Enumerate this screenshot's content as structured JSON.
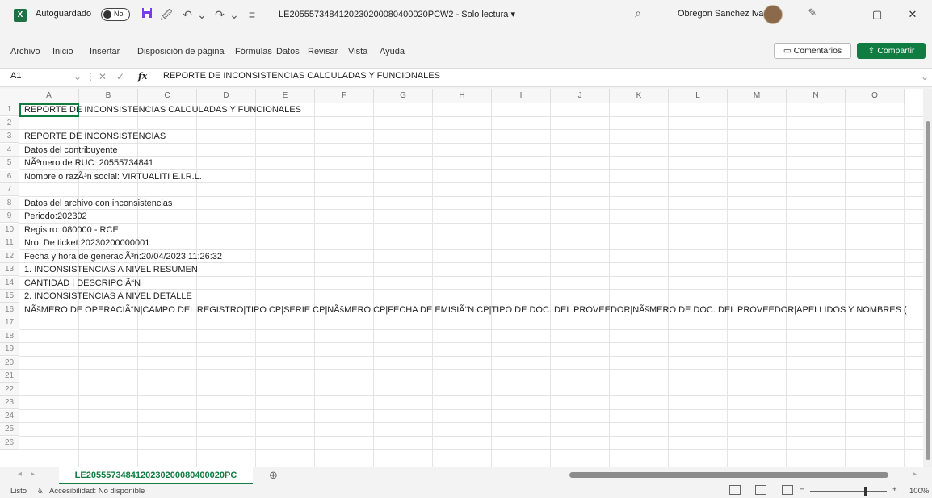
{
  "titlebar": {
    "app_icon": "X",
    "autosave_label": "Autoguardado",
    "autosave_state": "No",
    "doc_title": "LE2055573484120230200080400020PCW2 - Solo lectura ▾",
    "username": "Obregon Sanchez Ivan"
  },
  "menu": {
    "tabs": [
      "Archivo",
      "Inicio",
      "Insertar",
      "Disposición de página",
      "Fórmulas",
      "Datos",
      "Revisar",
      "Vista",
      "Ayuda"
    ],
    "comments_label": "Comentarios",
    "share_label": "Compartir"
  },
  "formula_bar": {
    "name_box": "A1",
    "fx": "fx",
    "content": "REPORTE DE INCONSISTENCIAS CALCULADAS Y FUNCIONALES"
  },
  "columns": [
    "A",
    "B",
    "C",
    "D",
    "E",
    "F",
    "G",
    "H",
    "I",
    "J",
    "K",
    "L",
    "M",
    "N",
    "O"
  ],
  "rows": [
    "1",
    "2",
    "3",
    "4",
    "5",
    "6",
    "7",
    "8",
    "9",
    "10",
    "11",
    "12",
    "13",
    "14",
    "15",
    "16",
    "17",
    "18",
    "19",
    "20",
    "21",
    "22",
    "23",
    "24",
    "25",
    "26"
  ],
  "cells": [
    "REPORTE DE INCONSISTENCIAS CALCULADAS Y FUNCIONALES",
    "",
    "REPORTE DE INCONSISTENCIAS",
    "Datos del contribuyente",
    "NÃºmero de RUC: 20555734841",
    "Nombre o razÃ³n social: VIRTUALITI E.I.R.L.",
    "",
    "Datos del archivo con inconsistencias",
    "Periodo:202302",
    "Registro: 080000 - RCE",
    "Nro. De ticket:20230200000001",
    "Fecha y hora de generaciÃ³n:20/04/2023 11:26:32",
    "1. INCONSISTENCIAS A NIVEL RESUMEN",
    "CANTIDAD | DESCRIPCIÃ“N",
    "2. INCONSISTENCIAS A NIVEL DETALLE",
    "NÃšMERO DE OPERACIÃ“N|CAMPO DEL REGISTRO|TIPO CP|SERIE CP|NÃšMERO CP|FECHA DE EMISIÃ“N CP|TIPO DE DOC. DEL PROVEEDOR|NÃšMERO DE DOC. DEL PROVEEDOR|APELLIDOS Y NOMBRES ("
  ],
  "sheet": {
    "tab_name": "LE2055573484120230200080400020PC",
    "add_icon": "⊕"
  },
  "status": {
    "ready": "Listo",
    "accessibility": "Accesibilidad: No disponible",
    "zoom": "100%"
  }
}
